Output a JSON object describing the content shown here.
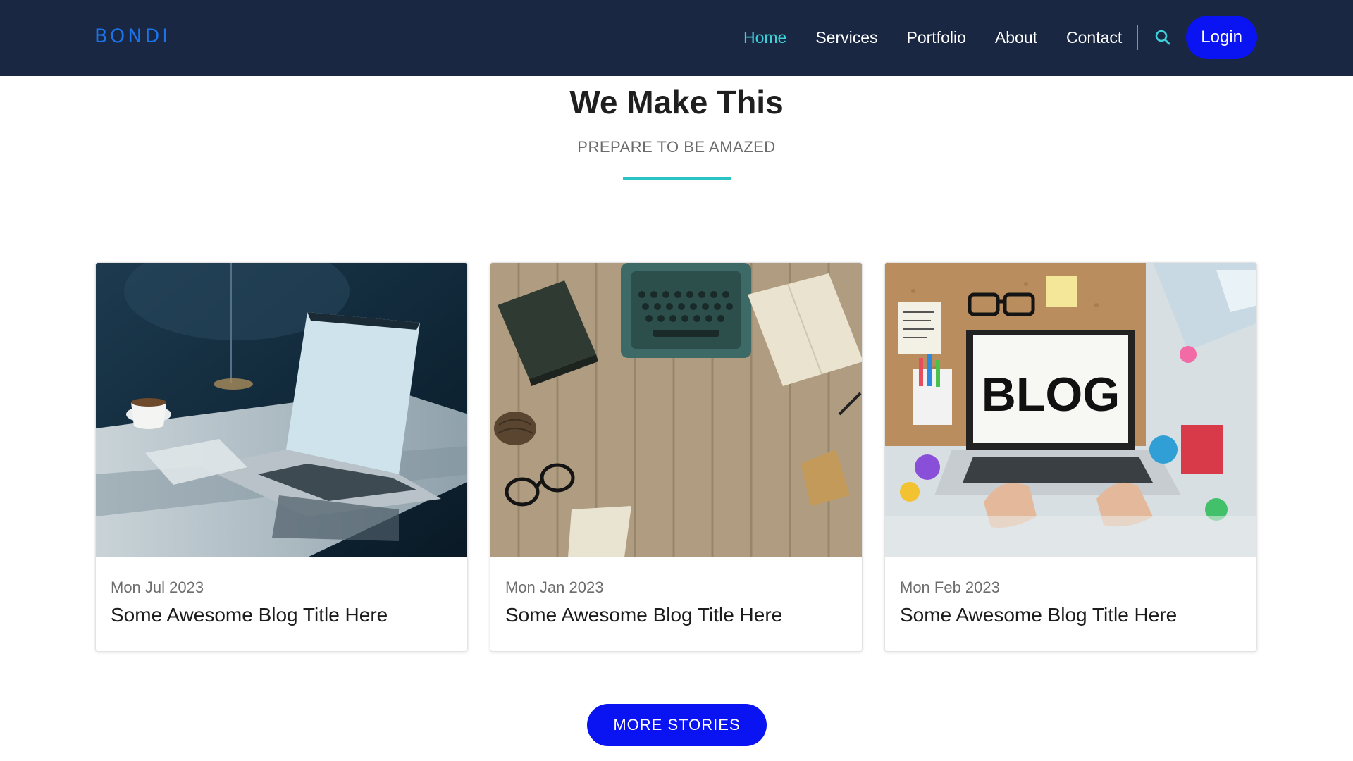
{
  "brand": {
    "name": "BONDI",
    "color": "#1a73e8"
  },
  "nav": {
    "links": [
      "Home",
      "Services",
      "Portfolio",
      "About",
      "Contact"
    ],
    "active": "Home",
    "search_icon": "search-icon",
    "login_label": "Login"
  },
  "section": {
    "title": "We Make This",
    "subtitle": "PREPARE TO BE AMAZED"
  },
  "cards": [
    {
      "date": "Mon Jul 2023",
      "title": "Some Awesome Blog Title Here",
      "image": "laptop-on-desk-photo"
    },
    {
      "date": "Mon Jan 2023",
      "title": "Some Awesome Blog Title Here",
      "image": "typewriter-on-wood-photo"
    },
    {
      "date": "Mon Feb 2023",
      "title": "Some Awesome Blog Title Here",
      "image": "blog-laptop-photo",
      "image_text": "BLOG"
    }
  ],
  "more_label": "MORE STORIES",
  "colors": {
    "navbar_bg": "#1a2742",
    "accent": "#3ed0d8",
    "button_blue": "#0a14f2",
    "underline": "#2bc4c4"
  }
}
